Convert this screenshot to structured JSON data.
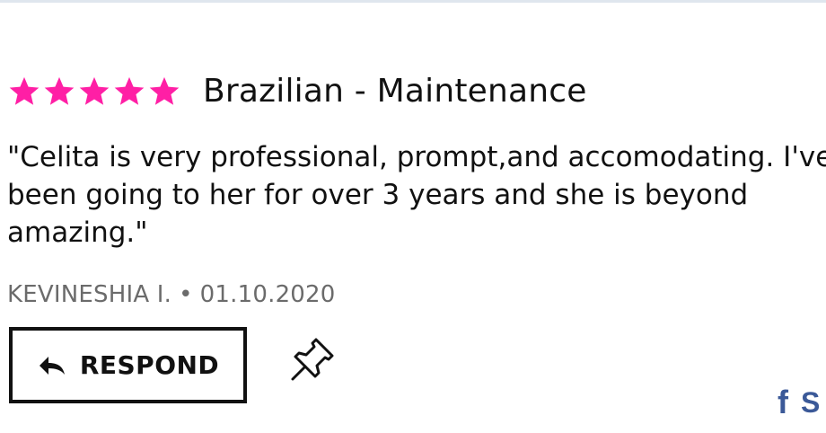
{
  "review": {
    "rating": 5,
    "rating_max": 5,
    "star_color": "#ff1fa5",
    "service": "Brazilian - Maintenance",
    "text": "\"Celita is very professional, prompt,and accomodating. I've\nbeen going to her for over 3 years and she is beyond\namazing.\"",
    "author": "KEVINESHIA I.",
    "separator": "•",
    "date": "01.10.2020"
  },
  "actions": {
    "respond_label": "RESPOND",
    "respond_icon": "reply-arrow-icon",
    "pin_icon": "pushpin-icon"
  },
  "share": {
    "facebook_icon": "f",
    "facebook_label": "S",
    "facebook_color": "#3b5998"
  }
}
